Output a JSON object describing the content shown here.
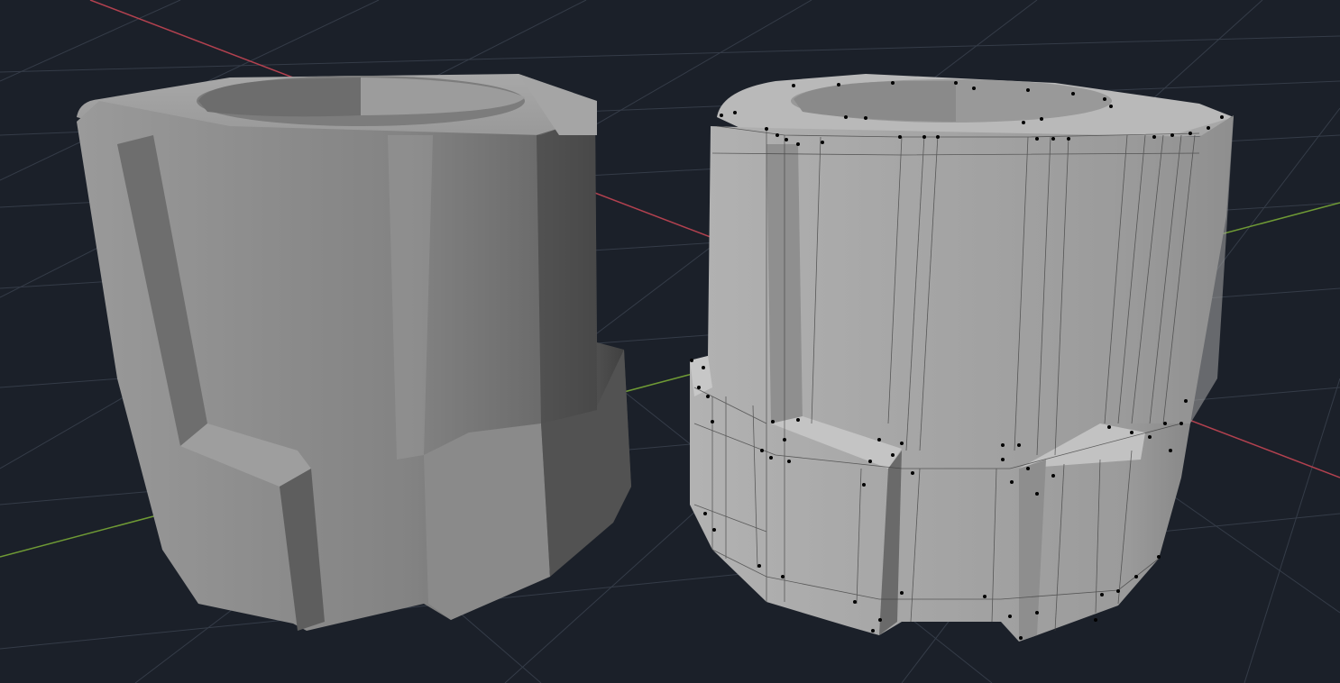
{
  "viewport": {
    "background": "#1b2029",
    "grid_color": "#3a414e",
    "x_axis_color": "#c0404f",
    "y_axis_color": "#7aa83a"
  },
  "objects": [
    {
      "name": "smooth-shaded-mesh",
      "shading": "smooth",
      "base_color": "#8f8f8f"
    },
    {
      "name": "wireframe-overlay-mesh",
      "shading": "flat",
      "base_color": "#a3a3a3",
      "vertex_color": "#000000"
    }
  ]
}
